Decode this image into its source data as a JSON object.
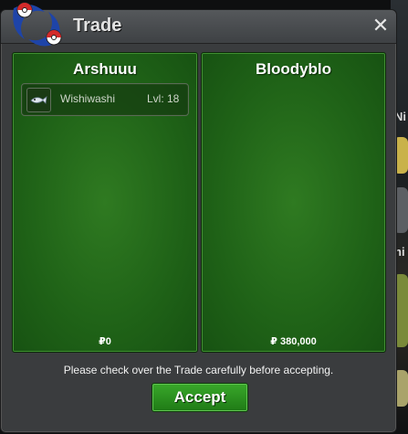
{
  "window": {
    "title": "Trade",
    "close_symbol": "✕"
  },
  "background": {
    "fragment_top": "Ni",
    "fragment_bottom": "ni"
  },
  "left_panel": {
    "player_name": "Arshuuu",
    "pokemon": [
      {
        "name": "Wishiwashi",
        "level": "Lvl: 18",
        "icon": "wishiwashi-icon"
      }
    ],
    "money": "₽0"
  },
  "right_panel": {
    "player_name": "Bloodyblo",
    "pokemon": [],
    "money": "₽ 380,000"
  },
  "footer": {
    "notice": "Please check over the Trade carefully before accepting.",
    "accept_label": "Accept"
  },
  "colors": {
    "panel_green": "#1f6217",
    "accept_green": "#2b8f20",
    "window_gray": "#3a3c3e",
    "logo_blue": "#1e44a8",
    "logo_red": "#d22a2a"
  }
}
